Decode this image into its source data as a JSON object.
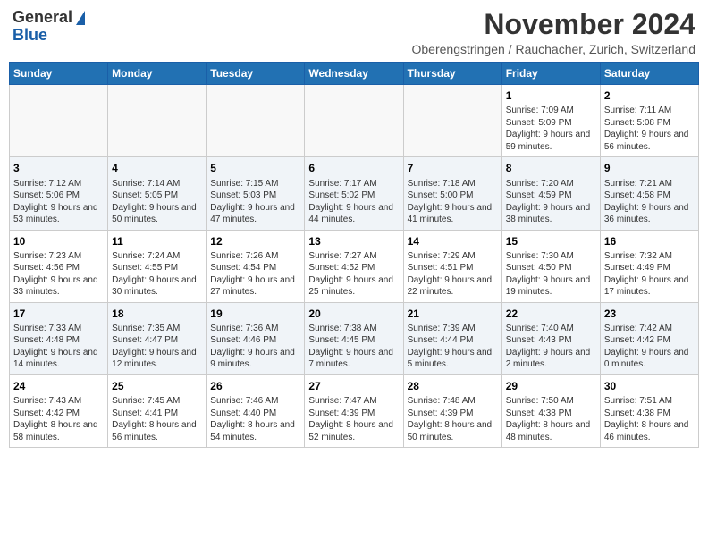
{
  "header": {
    "logo_general": "General",
    "logo_blue": "Blue",
    "month_title": "November 2024",
    "subtitle": "Oberengstringen / Rauchacher, Zurich, Switzerland"
  },
  "weekdays": [
    "Sunday",
    "Monday",
    "Tuesday",
    "Wednesday",
    "Thursday",
    "Friday",
    "Saturday"
  ],
  "weeks": [
    {
      "days": [
        {
          "num": "",
          "info": ""
        },
        {
          "num": "",
          "info": ""
        },
        {
          "num": "",
          "info": ""
        },
        {
          "num": "",
          "info": ""
        },
        {
          "num": "",
          "info": ""
        },
        {
          "num": "1",
          "info": "Sunrise: 7:09 AM\nSunset: 5:09 PM\nDaylight: 9 hours and 59 minutes."
        },
        {
          "num": "2",
          "info": "Sunrise: 7:11 AM\nSunset: 5:08 PM\nDaylight: 9 hours and 56 minutes."
        }
      ]
    },
    {
      "days": [
        {
          "num": "3",
          "info": "Sunrise: 7:12 AM\nSunset: 5:06 PM\nDaylight: 9 hours and 53 minutes."
        },
        {
          "num": "4",
          "info": "Sunrise: 7:14 AM\nSunset: 5:05 PM\nDaylight: 9 hours and 50 minutes."
        },
        {
          "num": "5",
          "info": "Sunrise: 7:15 AM\nSunset: 5:03 PM\nDaylight: 9 hours and 47 minutes."
        },
        {
          "num": "6",
          "info": "Sunrise: 7:17 AM\nSunset: 5:02 PM\nDaylight: 9 hours and 44 minutes."
        },
        {
          "num": "7",
          "info": "Sunrise: 7:18 AM\nSunset: 5:00 PM\nDaylight: 9 hours and 41 minutes."
        },
        {
          "num": "8",
          "info": "Sunrise: 7:20 AM\nSunset: 4:59 PM\nDaylight: 9 hours and 38 minutes."
        },
        {
          "num": "9",
          "info": "Sunrise: 7:21 AM\nSunset: 4:58 PM\nDaylight: 9 hours and 36 minutes."
        }
      ]
    },
    {
      "days": [
        {
          "num": "10",
          "info": "Sunrise: 7:23 AM\nSunset: 4:56 PM\nDaylight: 9 hours and 33 minutes."
        },
        {
          "num": "11",
          "info": "Sunrise: 7:24 AM\nSunset: 4:55 PM\nDaylight: 9 hours and 30 minutes."
        },
        {
          "num": "12",
          "info": "Sunrise: 7:26 AM\nSunset: 4:54 PM\nDaylight: 9 hours and 27 minutes."
        },
        {
          "num": "13",
          "info": "Sunrise: 7:27 AM\nSunset: 4:52 PM\nDaylight: 9 hours and 25 minutes."
        },
        {
          "num": "14",
          "info": "Sunrise: 7:29 AM\nSunset: 4:51 PM\nDaylight: 9 hours and 22 minutes."
        },
        {
          "num": "15",
          "info": "Sunrise: 7:30 AM\nSunset: 4:50 PM\nDaylight: 9 hours and 19 minutes."
        },
        {
          "num": "16",
          "info": "Sunrise: 7:32 AM\nSunset: 4:49 PM\nDaylight: 9 hours and 17 minutes."
        }
      ]
    },
    {
      "days": [
        {
          "num": "17",
          "info": "Sunrise: 7:33 AM\nSunset: 4:48 PM\nDaylight: 9 hours and 14 minutes."
        },
        {
          "num": "18",
          "info": "Sunrise: 7:35 AM\nSunset: 4:47 PM\nDaylight: 9 hours and 12 minutes."
        },
        {
          "num": "19",
          "info": "Sunrise: 7:36 AM\nSunset: 4:46 PM\nDaylight: 9 hours and 9 minutes."
        },
        {
          "num": "20",
          "info": "Sunrise: 7:38 AM\nSunset: 4:45 PM\nDaylight: 9 hours and 7 minutes."
        },
        {
          "num": "21",
          "info": "Sunrise: 7:39 AM\nSunset: 4:44 PM\nDaylight: 9 hours and 5 minutes."
        },
        {
          "num": "22",
          "info": "Sunrise: 7:40 AM\nSunset: 4:43 PM\nDaylight: 9 hours and 2 minutes."
        },
        {
          "num": "23",
          "info": "Sunrise: 7:42 AM\nSunset: 4:42 PM\nDaylight: 9 hours and 0 minutes."
        }
      ]
    },
    {
      "days": [
        {
          "num": "24",
          "info": "Sunrise: 7:43 AM\nSunset: 4:42 PM\nDaylight: 8 hours and 58 minutes."
        },
        {
          "num": "25",
          "info": "Sunrise: 7:45 AM\nSunset: 4:41 PM\nDaylight: 8 hours and 56 minutes."
        },
        {
          "num": "26",
          "info": "Sunrise: 7:46 AM\nSunset: 4:40 PM\nDaylight: 8 hours and 54 minutes."
        },
        {
          "num": "27",
          "info": "Sunrise: 7:47 AM\nSunset: 4:39 PM\nDaylight: 8 hours and 52 minutes."
        },
        {
          "num": "28",
          "info": "Sunrise: 7:48 AM\nSunset: 4:39 PM\nDaylight: 8 hours and 50 minutes."
        },
        {
          "num": "29",
          "info": "Sunrise: 7:50 AM\nSunset: 4:38 PM\nDaylight: 8 hours and 48 minutes."
        },
        {
          "num": "30",
          "info": "Sunrise: 7:51 AM\nSunset: 4:38 PM\nDaylight: 8 hours and 46 minutes."
        }
      ]
    }
  ]
}
